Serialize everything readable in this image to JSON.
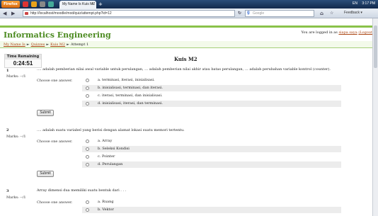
{
  "taskbar": {
    "firefox_label": "Firefox",
    "tab_title": "My Name Is Kuis M2",
    "newtab_label": "+",
    "tray_lang": "EN",
    "clock": "3:17 PM"
  },
  "navbar": {
    "back_label": "◀",
    "forward_label": "▶",
    "url": "http://localhost/moodle/mod/quiz/attempt.php?id=12",
    "search_placeholder": "Google",
    "search_engine_icon": "g",
    "feedback_label": "Feedback ▾"
  },
  "header": {
    "site_title": "Informatics Engineering",
    "login_prefix": "You are logged in as ",
    "login_user": "siapa saya",
    "login_logout": "(Logout)"
  },
  "breadcrumb": {
    "items": [
      "My Name Is",
      "Quizzes",
      "Kuis M2",
      "Attempt 1"
    ],
    "separator": "►"
  },
  "timer": {
    "label": "Time Remaining",
    "value": "0:24:51"
  },
  "quiz": {
    "title": "Kuis M2",
    "choose_label": "Choose one answer.",
    "marks_label": "Marks: --/1",
    "submit_label": "Submit",
    "questions": [
      {
        "number": "1",
        "text": "…. adalah pemberian nilai awal variable untuk perulangan, … adalah pemberian nilai akhir atau batas perulangan, … adalah perubahan variable kontrol (counter).",
        "options": [
          "a. terminasi, iterasi, inisialisasi.",
          "b. inisialisasi, terminasi, dan iterasi.",
          "c. iterasi, terminasi, dan inisialisasi.",
          "d. inisialisasi, iterasi, dan terminasi."
        ]
      },
      {
        "number": "2",
        "text": "…. adalah suatu variabel yang berisi dengan alamat lokasi suatu memori tertentu.",
        "options": [
          "a. Array",
          "b. Seleksi Kondisi",
          "c. Pointer",
          "d. Perulangan"
        ]
      },
      {
        "number": "3",
        "text": "Array dimensi dua memiliki suatu bentuk dari . . .",
        "options": [
          "a. Ruang",
          "b. Vektor"
        ]
      }
    ]
  },
  "colors": {
    "site_title": "#4b8a1f",
    "green_accent": "#8ac24a",
    "link": "#a41"
  }
}
